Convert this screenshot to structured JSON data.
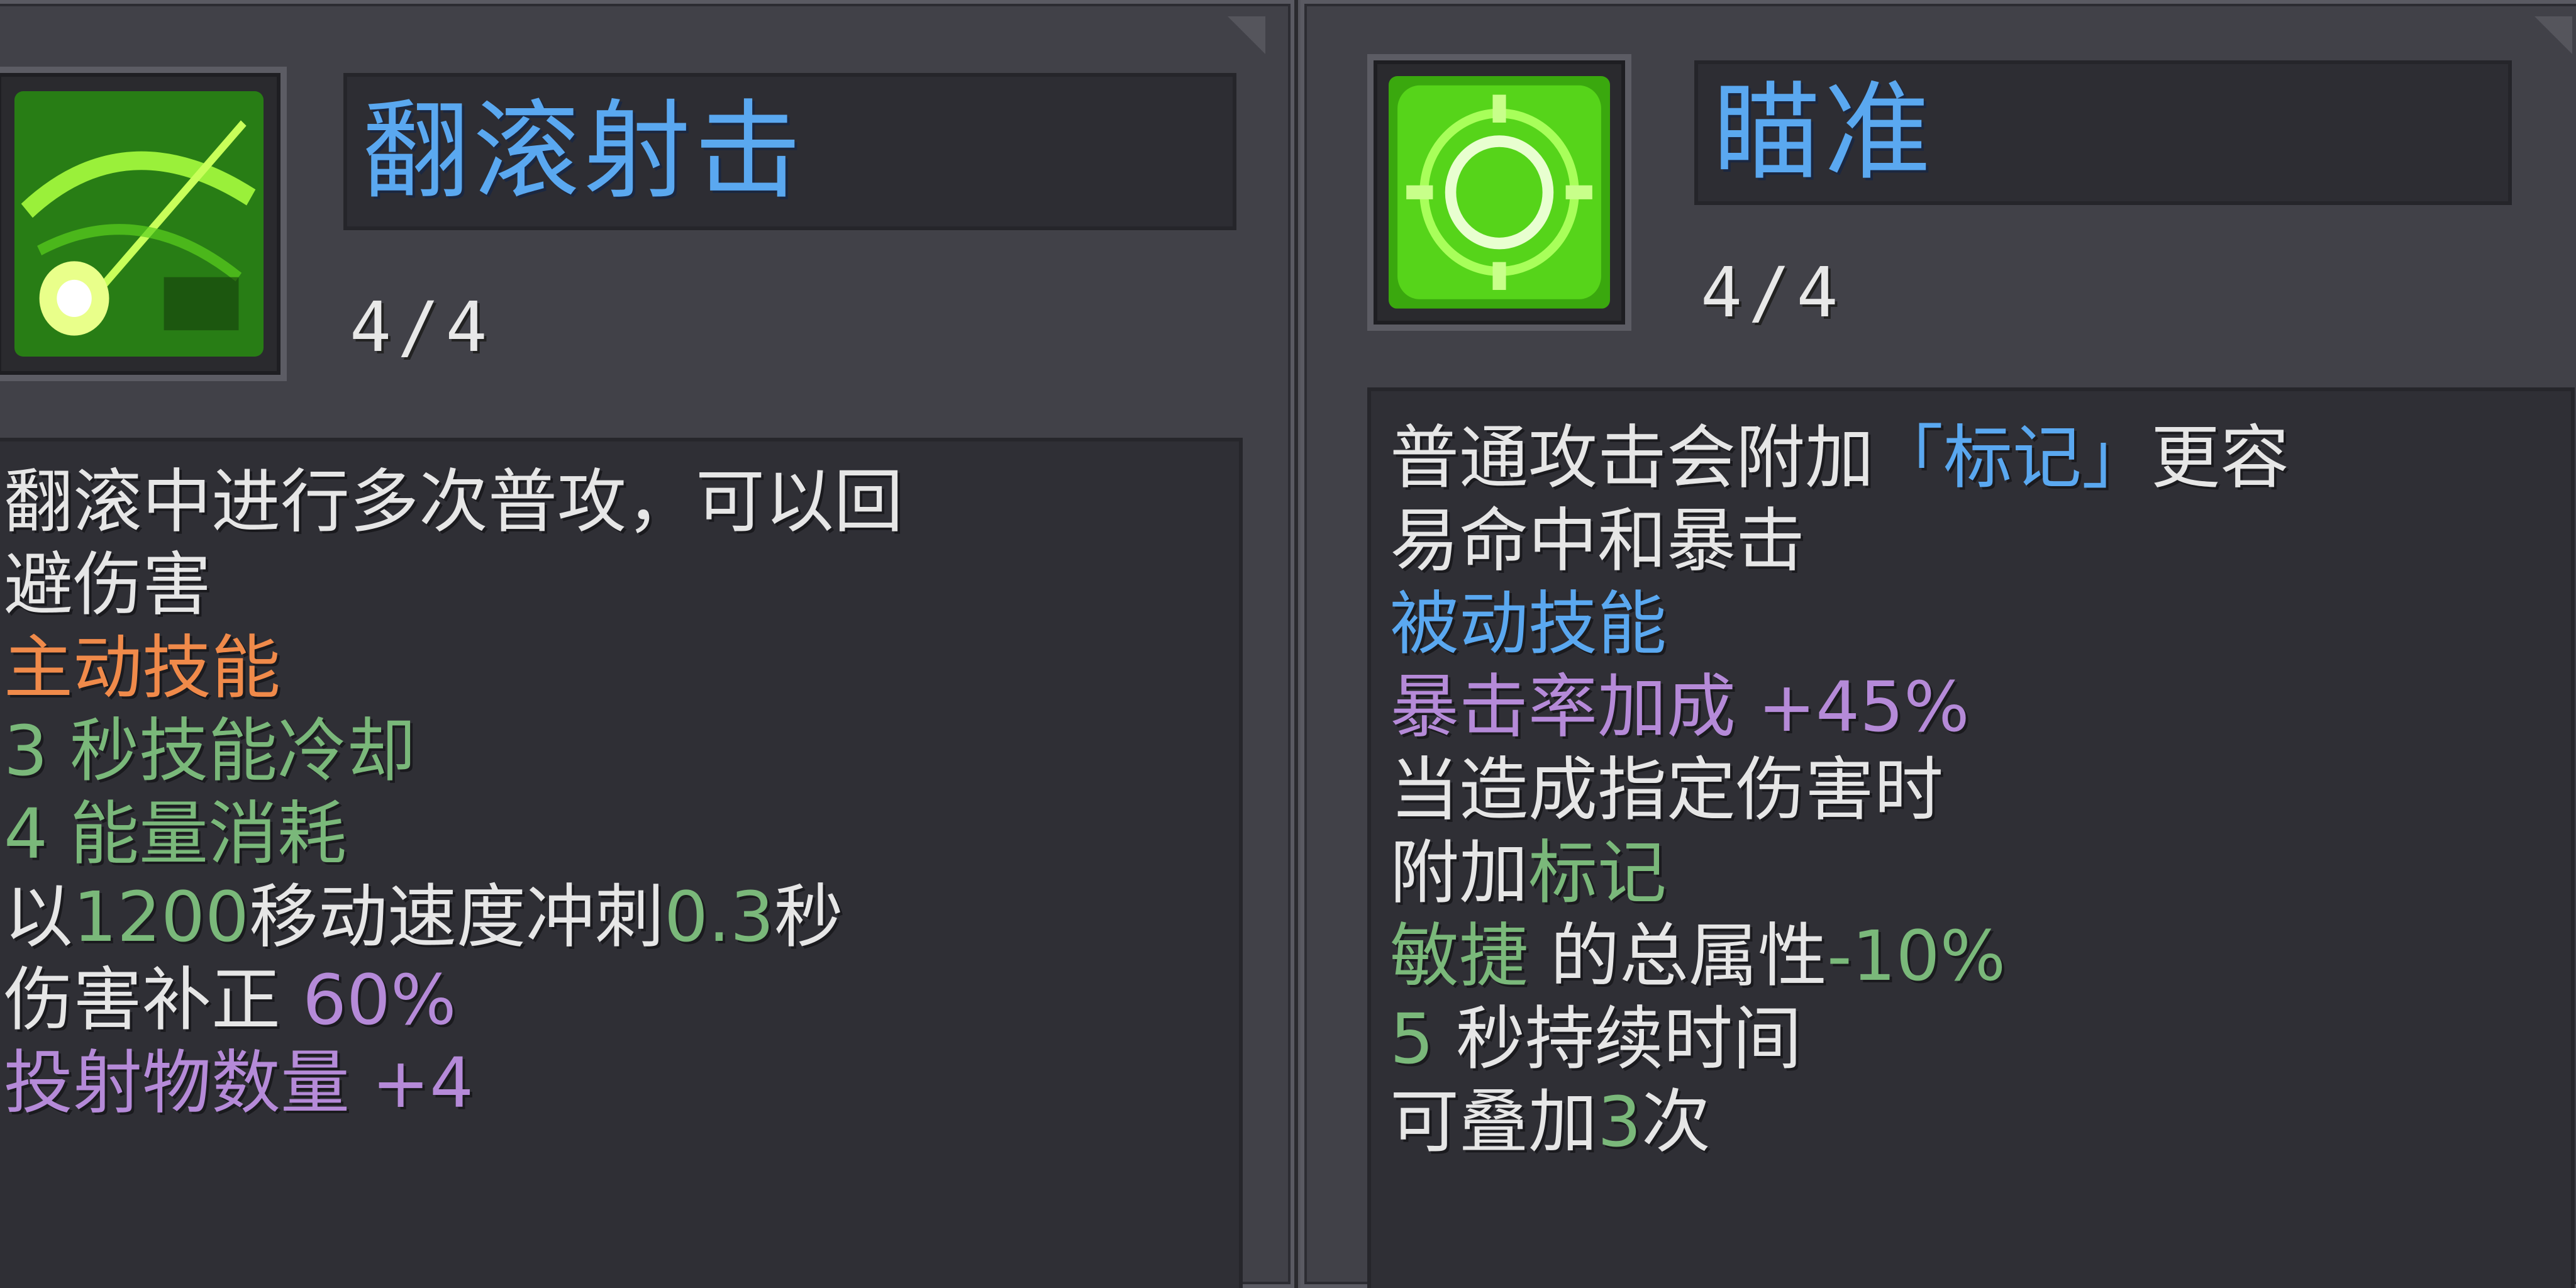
{
  "left_card": {
    "icon": "rolling-shot-bow-icon",
    "title": "翻滚射击",
    "level": "4/4",
    "desc_line1": "翻滚中进行多次普攻，可以回",
    "desc_line2": "避伤害",
    "type": "主动技能",
    "cooldown": "3 秒技能冷却",
    "energy": "4 能量消耗",
    "dash_prefix": "以",
    "dash_speed": "1200",
    "dash_mid": "移动速度冲刺",
    "dash_time": "0.3",
    "dash_suffix": "秒",
    "damage_label": "伤害补正 ",
    "damage_value": "60%",
    "projectile_label": "投射物数量 ",
    "projectile_value": "+4"
  },
  "right_card": {
    "icon": "aim-crosshair-icon",
    "title": "瞄准",
    "level": "4/4",
    "desc_a": "普通攻击会附加",
    "desc_mark": "「标记」",
    "desc_b": "更容",
    "desc_line2": "易命中和暴击",
    "type": "被动技能",
    "crit_label": "暴击率加成 ",
    "crit_value": "+45%",
    "trigger": "当造成指定伤害时",
    "apply_prefix": "附加",
    "apply_mark": "标记",
    "agility_label": "敏捷",
    "agility_mid": " 的总属性",
    "agility_value": "-10%",
    "duration_num": "5",
    "duration_text": " 秒持续时间",
    "stack_prefix": "可叠加",
    "stack_num": "3",
    "stack_suffix": "次"
  },
  "colors": {
    "title_blue": "#5aa8f0",
    "active_orange": "#f08a4a",
    "stat_green": "#7ab87a",
    "stat_purple": "#b58ad8",
    "icon_green": "#5ad01e"
  }
}
